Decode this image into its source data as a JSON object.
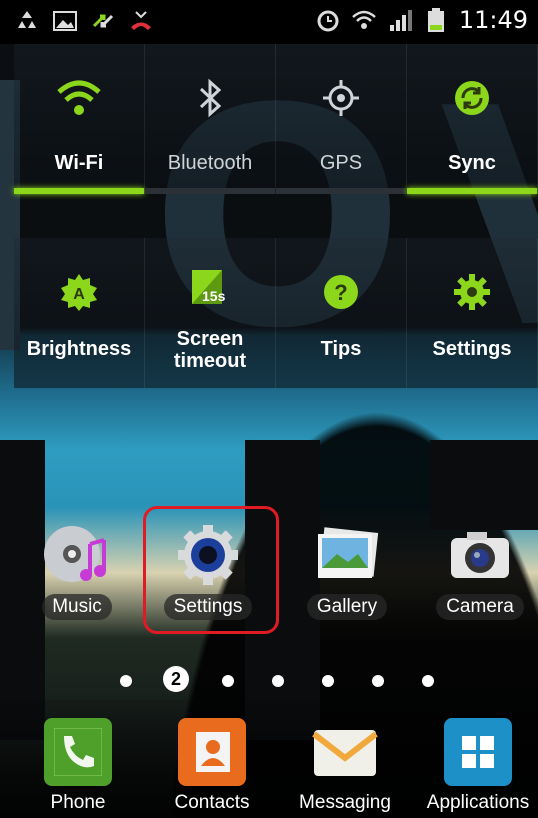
{
  "status_bar": {
    "time": "11:49",
    "left_icons": [
      "recycle-icon",
      "gallery-icon",
      "transfer-icon",
      "missed-call-icon"
    ],
    "right_icons": [
      "alarm-icon",
      "wifi-icon",
      "signal-icon",
      "battery-icon"
    ]
  },
  "quick_panel": {
    "row1": [
      {
        "label": "Wi-Fi",
        "icon": "wifi-icon",
        "enabled": true
      },
      {
        "label": "Bluetooth",
        "icon": "bluetooth-icon",
        "enabled": false
      },
      {
        "label": "GPS",
        "icon": "gps-icon",
        "enabled": false
      },
      {
        "label": "Sync",
        "icon": "sync-icon",
        "enabled": true
      }
    ],
    "row2": [
      {
        "label": "Brightness",
        "icon": "brightness-icon"
      },
      {
        "label": "Screen timeout",
        "icon": "screen-timeout-icon",
        "badge": "15s"
      },
      {
        "label": "Tips",
        "icon": "tips-icon"
      },
      {
        "label": "Settings",
        "icon": "settings-gear-icon"
      }
    ]
  },
  "home": {
    "apps": [
      {
        "label": "Music",
        "icon": "music-icon"
      },
      {
        "label": "Settings",
        "icon": "settings-icon"
      },
      {
        "label": "Gallery",
        "icon": "gallery-icon"
      },
      {
        "label": "Camera",
        "icon": "camera-icon"
      }
    ],
    "current_page": "2"
  },
  "dock": [
    {
      "label": "Phone",
      "icon": "phone-icon"
    },
    {
      "label": "Contacts",
      "icon": "contacts-icon"
    },
    {
      "label": "Messaging",
      "icon": "messaging-icon"
    },
    {
      "label": "Applications",
      "icon": "applications-icon"
    }
  ],
  "colors": {
    "accent": "#8cd61c",
    "highlight": "#e01b24"
  }
}
